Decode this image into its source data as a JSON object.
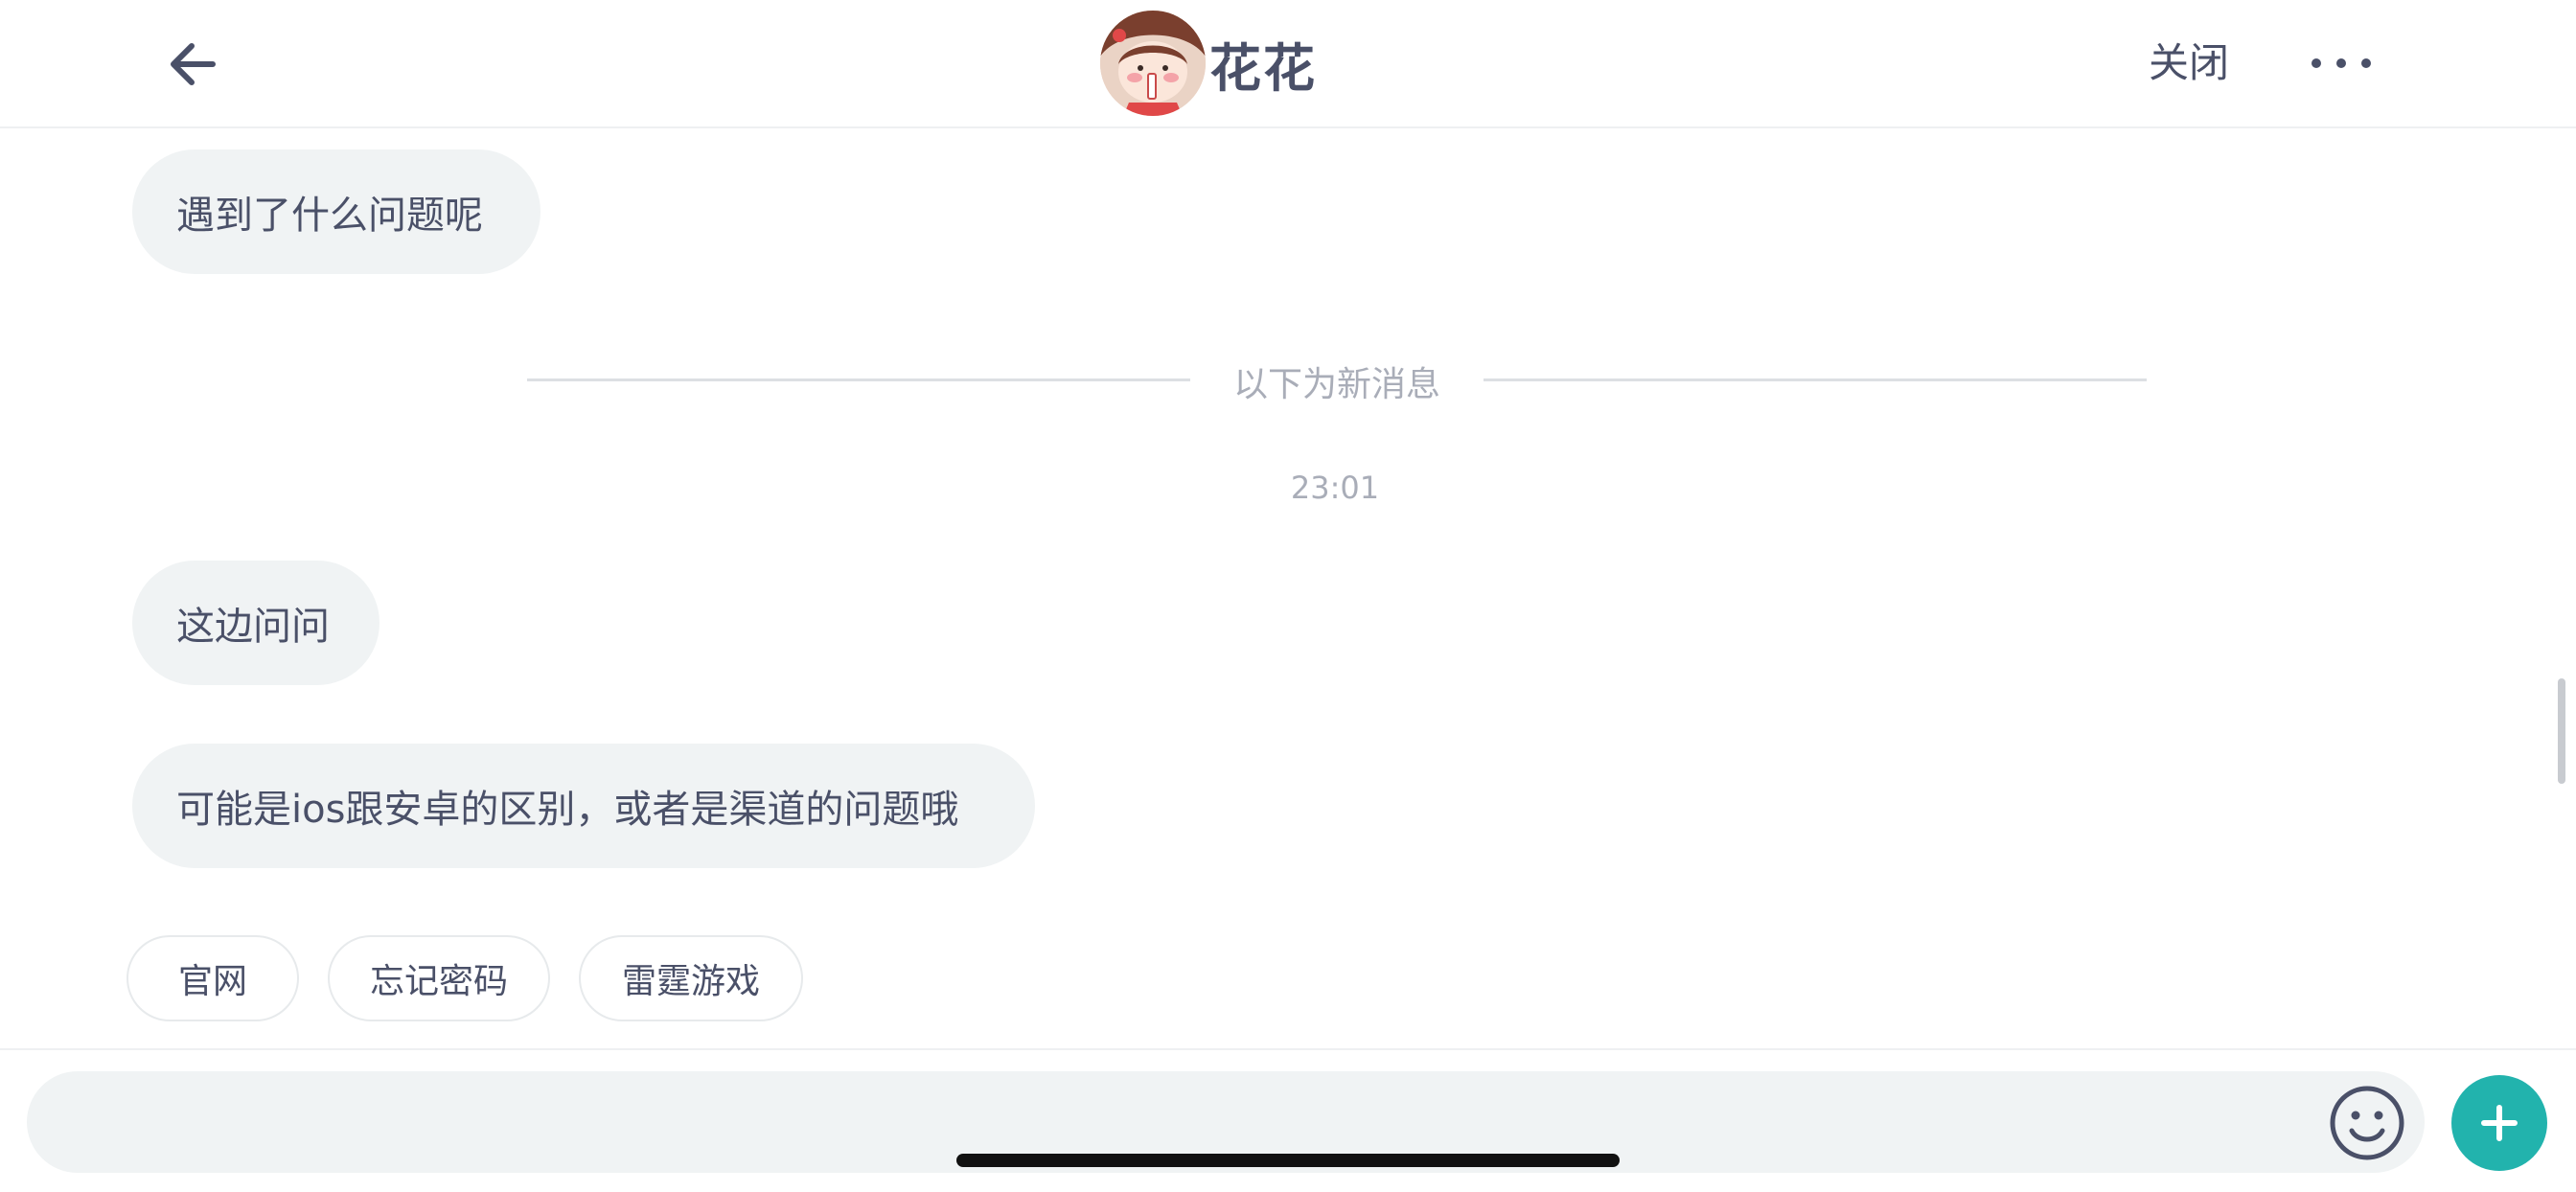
{
  "header": {
    "title": "花花",
    "close_label": "关闭",
    "back_icon": "arrow-left-icon",
    "more_icon": "more-horizontal-icon"
  },
  "messages": [
    {
      "text": "遇到了什么问题呢"
    },
    {
      "text": "这边问问"
    },
    {
      "text": "可能是ios跟安卓的区别，或者是渠道的问题哦"
    }
  ],
  "divider": {
    "text": "以下为新消息"
  },
  "timestamp": "23:01",
  "quick_replies": [
    {
      "label": "官网"
    },
    {
      "label": "忘记密码"
    },
    {
      "label": "雷霆游戏"
    }
  ],
  "input": {
    "value": "",
    "placeholder": "",
    "emoji_icon": "smiley-icon",
    "plus_icon": "plus-icon"
  },
  "colors": {
    "accent": "#22b3ad",
    "text": "#4a5068",
    "bubble_bg": "#f0f3f4",
    "muted_text": "#a9adb8"
  }
}
